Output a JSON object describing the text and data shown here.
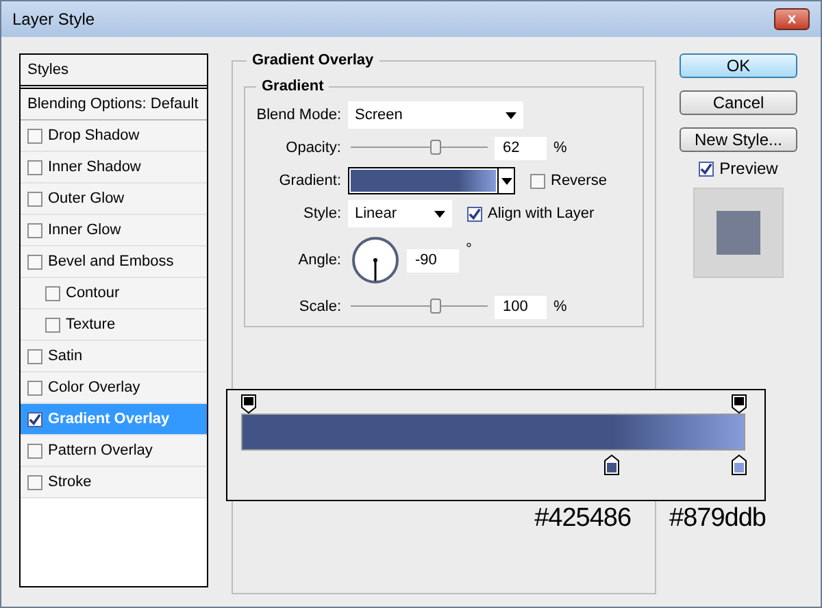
{
  "window": {
    "title": "Layer Style",
    "close": "x"
  },
  "sidebar": {
    "header": "Styles",
    "blending": "Blending Options: Default",
    "items": [
      {
        "label": "Drop Shadow",
        "checked": false,
        "selected": false
      },
      {
        "label": "Inner Shadow",
        "checked": false,
        "selected": false
      },
      {
        "label": "Outer Glow",
        "checked": false,
        "selected": false
      },
      {
        "label": "Inner Glow",
        "checked": false,
        "selected": false
      },
      {
        "label": "Bevel and Emboss",
        "checked": false,
        "selected": false,
        "children": [
          {
            "label": "Contour",
            "checked": false,
            "selected": false
          },
          {
            "label": "Texture",
            "checked": false,
            "selected": false
          }
        ]
      },
      {
        "label": "Satin",
        "checked": false,
        "selected": false
      },
      {
        "label": "Color Overlay",
        "checked": false,
        "selected": false
      },
      {
        "label": "Gradient Overlay",
        "checked": true,
        "selected": true
      },
      {
        "label": "Pattern Overlay",
        "checked": false,
        "selected": false
      },
      {
        "label": "Stroke",
        "checked": false,
        "selected": false
      }
    ]
  },
  "panel": {
    "title": "Gradient Overlay",
    "group": "Gradient",
    "blend_mode": {
      "label": "Blend Mode:",
      "value": "Screen"
    },
    "opacity": {
      "label": "Opacity:",
      "level": 0.62,
      "value": "62",
      "unit": "%"
    },
    "gradient": {
      "label": "Gradient:",
      "reverse": {
        "label": "Reverse",
        "checked": false
      }
    },
    "style": {
      "label": "Style:",
      "value": "Linear",
      "align": {
        "label": "Align with Layer",
        "checked": true
      }
    },
    "angle": {
      "label": "Angle:",
      "value": "-90",
      "unit": "°"
    },
    "scale": {
      "label": "Scale:",
      "level": 0.62,
      "value": "100",
      "unit": "%"
    }
  },
  "buttons": [
    {
      "label": "OK",
      "default": true
    },
    {
      "label": "Cancel",
      "default": false
    },
    {
      "label": "New Style...",
      "default": false
    }
  ],
  "preview": {
    "label": "Preview",
    "checked": true
  },
  "gradient_editor": {
    "opacity_stops": [
      {
        "level": 0
      },
      {
        "level": 1
      }
    ],
    "color_stops": [
      {
        "level": 0.74,
        "color": "#425486"
      },
      {
        "level": 1,
        "color": "#879ddb"
      }
    ],
    "labels": [
      "#425486",
      "#879ddb"
    ]
  }
}
